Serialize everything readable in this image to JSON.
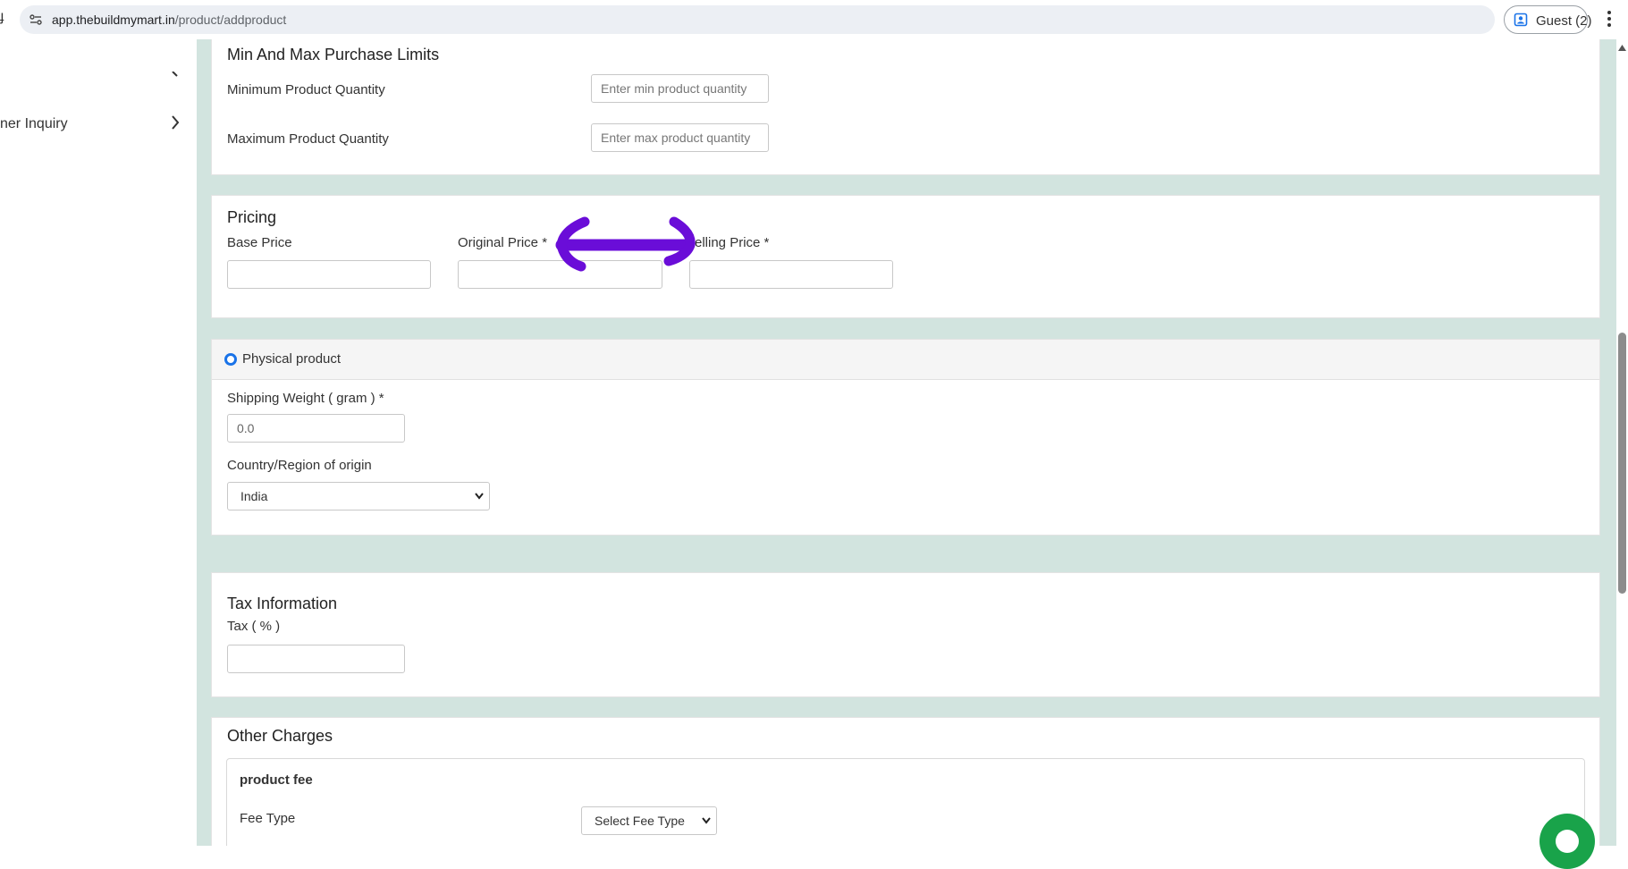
{
  "browser": {
    "url_host": "app.thebuildmymart.in",
    "url_path": "/product/addproduct",
    "profile_label": "Guest (2)"
  },
  "sidebar": {
    "items": [
      {
        "label": "ner Inquiry"
      }
    ]
  },
  "purchase_limits": {
    "title": "Min And Max Purchase Limits",
    "min_label": "Minimum Product Quantity",
    "min_placeholder": "Enter min product quantity",
    "max_label": "Maximum Product Quantity",
    "max_placeholder": "Enter max product quantity"
  },
  "pricing": {
    "title": "Pricing",
    "base_price_label": "Base Price",
    "original_price_label": "Original Price *",
    "selling_price_label": "elling Price *"
  },
  "physical": {
    "radio_label": "Physical product",
    "shipping_weight_label": "Shipping Weight ( gram ) *",
    "shipping_weight_value": "0.0",
    "country_label": "Country/Region of origin",
    "country_value": "India"
  },
  "tax": {
    "title": "Tax Information",
    "tax_label": "Tax ( % )"
  },
  "other_charges": {
    "title": "Other Charges",
    "fee_title": "product fee",
    "fee_type_label": "Fee Type",
    "fee_type_value": "Select Fee Type"
  },
  "colors": {
    "accent": "#1a73e8",
    "page_bg": "#d2e4df",
    "annotation": "#6a0dd8",
    "chat": "#19a34a"
  }
}
